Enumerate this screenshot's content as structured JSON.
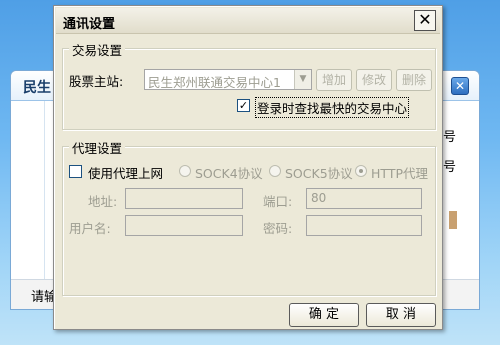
{
  "background_window": {
    "title": "民生",
    "right_text_1": "号",
    "right_text_2": "号",
    "bottom_text": "请输",
    "close_glyph": "✕"
  },
  "dialog": {
    "title": "通讯设置",
    "close_glyph": "✕",
    "trading": {
      "legend": "交易设置",
      "host_label": "股票主站:",
      "host_value": "民生郑州联通交易中心1",
      "add_label": "增加",
      "edit_label": "修改",
      "delete_label": "删除",
      "fastest_label": "登录时查找最快的交易中心",
      "fastest_checked": true
    },
    "proxy": {
      "legend": "代理设置",
      "use_proxy_label": "使用代理上网",
      "use_proxy_checked": false,
      "options": [
        {
          "label": "SOCK4协议",
          "checked": false
        },
        {
          "label": "SOCK5协议",
          "checked": false
        },
        {
          "label": "HTTP代理",
          "checked": true
        }
      ],
      "address_label": "地址:",
      "address_value": "",
      "port_label": "端口:",
      "port_value": "80",
      "username_label": "用户名:",
      "username_value": "",
      "password_label": "密码:",
      "password_value": ""
    },
    "ok_label": "确  定",
    "cancel_label": "取  消"
  }
}
